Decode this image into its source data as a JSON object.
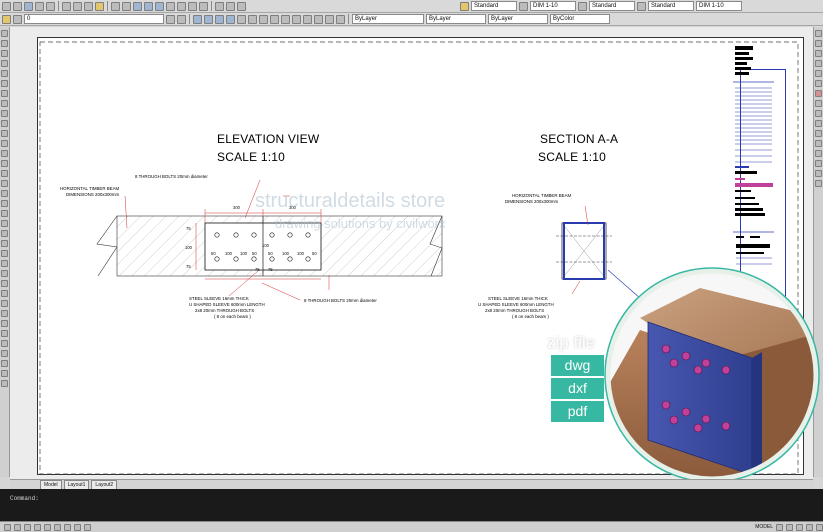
{
  "toolbar": {
    "layer_value": "0",
    "text_style": "Standard",
    "dim_style": "DIM 1-10",
    "table_style": "Standard",
    "multileader_style": "Standard",
    "right_dim_style": "DIM 1-10",
    "linetype_layer": "ByLayer",
    "lineweight_layer": "ByLayer",
    "color_layer": "ByLayer",
    "plot_style": "ByColor"
  },
  "tabs": [
    "Model",
    "Layout1",
    "Layout2"
  ],
  "command": {
    "prompt": "Command:"
  },
  "status": {
    "mode": "MODEL"
  },
  "drawing": {
    "elevation_title": "ELEVATION VIEW",
    "elevation_scale": "SCALE 1:10",
    "section_title": "SECTION A-A",
    "section_scale": "SCALE 1:10",
    "bolts_note_top": "8 THROUGH BOLTS 20mm diameter",
    "beam_note_line1": "HORIZONTAL TIMBER BEAM",
    "beam_note_line2": "DIMENSIONS 200x300mm",
    "sleeve_note_line1": "STEEL SLEEVE 16mm THICK",
    "sleeve_note_line2": "U SHAPED SLEEVE 600mm LENGTH",
    "sleeve_note_line3": "2x8 20mm THROUGH BOLTS",
    "sleeve_note_line4": "( 8 on each beam )",
    "bolts_note_bottom": "8 THROUGH BOLTS 20mm diameter",
    "section_beam_note_line1": "HORIZONTAL TIMBER BEAM",
    "section_beam_note_line2": "DIMENSIONS 200x300mm",
    "section_sleeve_line1": "STEEL SLEEVE 16mm THICK",
    "section_sleeve_line2": "U SHAPED SLEEVE 600mm LENGTH",
    "section_sleeve_line3": "2x8 20mm THROUGH BOLTS",
    "section_sleeve_line4": "( 8 on each beam )",
    "dims": {
      "d300a": "300",
      "d300b": "300",
      "d100a": "100",
      "d100b": "100",
      "d100c": "100",
      "d100d": "100",
      "d100e": "100",
      "d50a": "50",
      "d50b": "50",
      "d50c": "50",
      "d50d": "50",
      "d75a": "75",
      "d75b": "75",
      "v75a": "75",
      "v100": "100",
      "v75b": "75"
    }
  },
  "watermark": {
    "line1": "structuraldetails store",
    "line2": "drawing solutions by civilworx"
  },
  "download": {
    "label": "zip file",
    "formats": [
      "dwg",
      "dxf",
      "pdf"
    ]
  },
  "colors": {
    "accent": "#37b8a2",
    "sleeve": "#3f4fa0",
    "timber": "#b9825c",
    "annotation_red": "#d33030"
  }
}
